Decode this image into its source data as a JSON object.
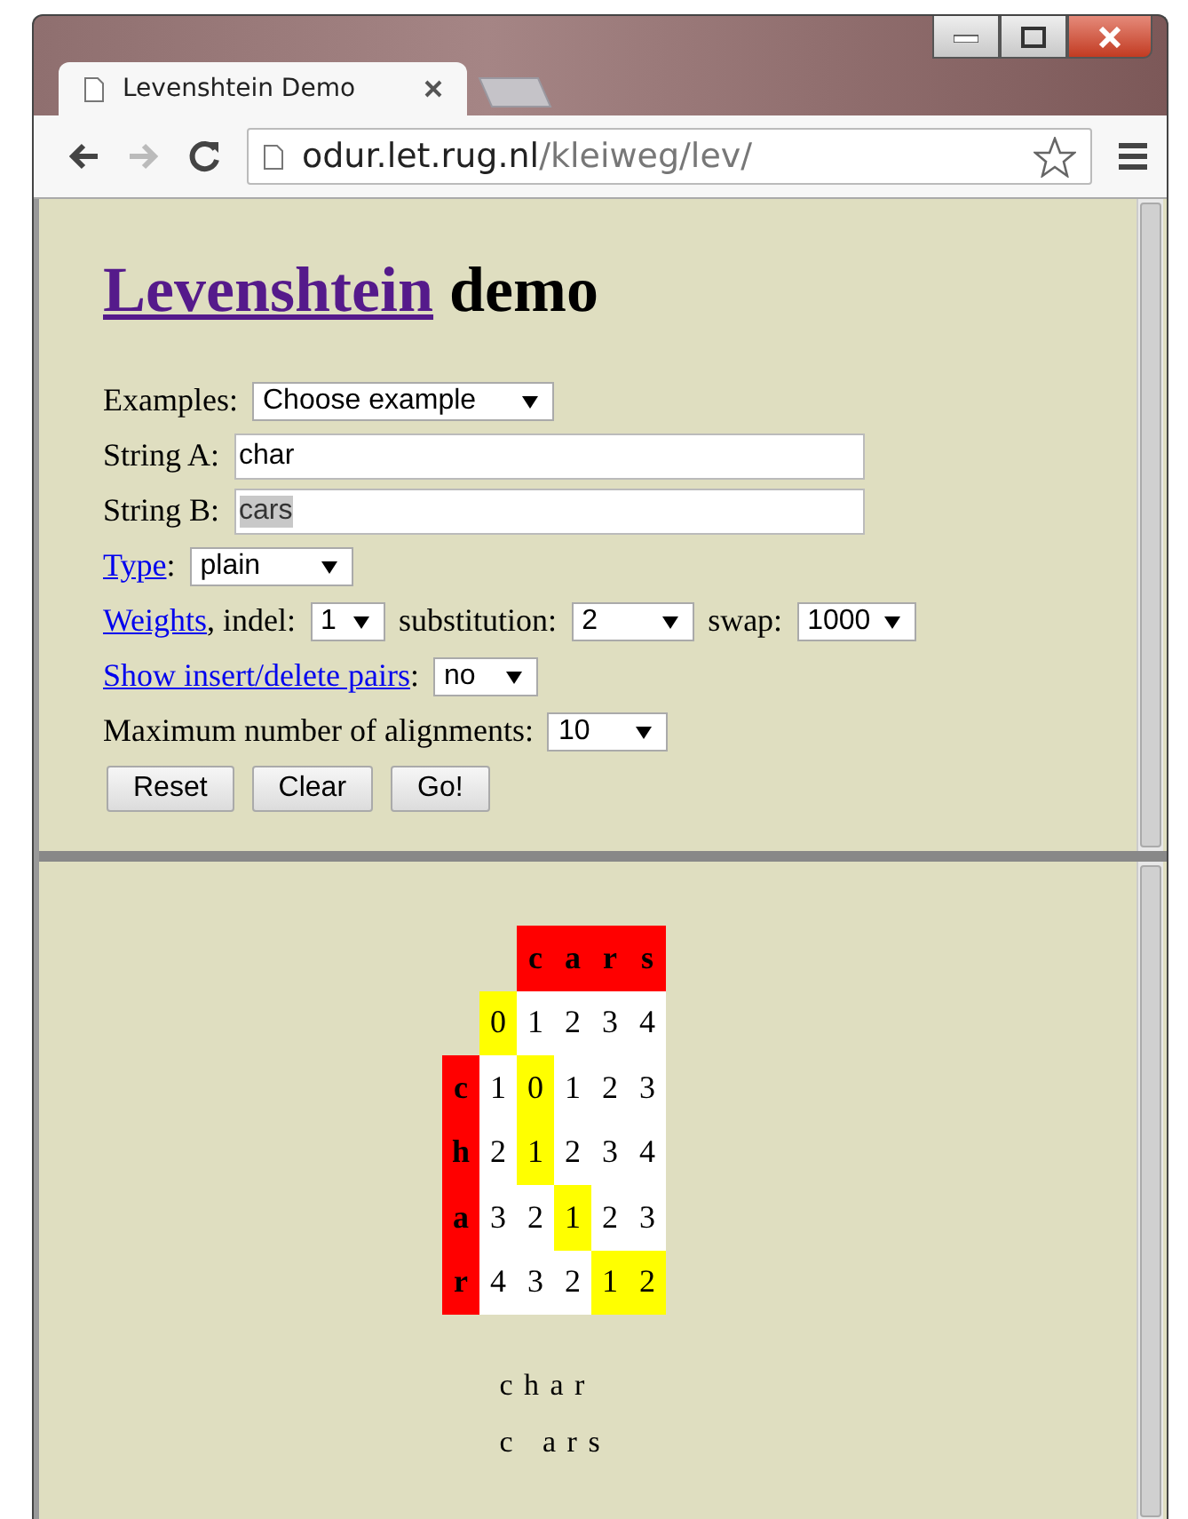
{
  "browser": {
    "tab_title": "Levenshtein Demo",
    "url_host": "odur.let.rug.nl",
    "url_path": "/kleiweg/lev/"
  },
  "heading": {
    "link": "Levenshtein",
    "rest": "demo"
  },
  "form": [
    [
      {
        "kind": "text",
        "text": "Examples:"
      },
      {
        "kind": "select",
        "value": "Choose example"
      }
    ],
    [
      {
        "kind": "text",
        "text": "String A:"
      },
      {
        "kind": "input",
        "value": "char",
        "highlighted": false
      }
    ],
    [
      {
        "kind": "text",
        "text": "String B:"
      },
      {
        "kind": "input",
        "value": "cars",
        "highlighted": true
      }
    ],
    [
      {
        "kind": "link",
        "text": "Type"
      },
      {
        "kind": "text",
        "text": ":"
      },
      {
        "kind": "select",
        "value": "plain"
      }
    ],
    [
      {
        "kind": "link",
        "text": "Weights"
      },
      {
        "kind": "text",
        "text": ", indel:"
      },
      {
        "kind": "select",
        "value": "1"
      },
      {
        "kind": "text",
        "text": "substitution:"
      },
      {
        "kind": "select",
        "value": "2"
      },
      {
        "kind": "text",
        "text": "swap:"
      },
      {
        "kind": "select",
        "value": "1000"
      }
    ],
    [
      {
        "kind": "link",
        "text": "Show insert/delete pairs"
      },
      {
        "kind": "text",
        "text": ":"
      },
      {
        "kind": "select",
        "value": "no"
      }
    ],
    [
      {
        "kind": "text",
        "text": "Maximum number of alignments:"
      },
      {
        "kind": "select",
        "value": "10"
      }
    ]
  ],
  "buttons": [
    "Reset",
    "Clear",
    "Go!"
  ],
  "matrix": {
    "columns": [
      "",
      "",
      "c",
      "a",
      "r",
      "s"
    ],
    "rows": [
      {
        "cells": [
          {
            "kind": "empty"
          },
          {
            "value": "0",
            "on_path": true
          },
          {
            "value": "1",
            "on_path": false
          },
          {
            "value": "2",
            "on_path": false
          },
          {
            "value": "3",
            "on_path": false
          },
          {
            "value": "4",
            "on_path": false
          }
        ]
      },
      {
        "cells": [
          {
            "kind": "header",
            "value": "c"
          },
          {
            "value": "1",
            "on_path": false
          },
          {
            "value": "0",
            "on_path": true
          },
          {
            "value": "1",
            "on_path": false
          },
          {
            "value": "2",
            "on_path": false
          },
          {
            "value": "3",
            "on_path": false
          }
        ]
      },
      {
        "cells": [
          {
            "kind": "header",
            "value": "h"
          },
          {
            "value": "2",
            "on_path": false
          },
          {
            "value": "1",
            "on_path": true
          },
          {
            "value": "2",
            "on_path": false
          },
          {
            "value": "3",
            "on_path": false
          },
          {
            "value": "4",
            "on_path": false
          }
        ]
      },
      {
        "cells": [
          {
            "kind": "header",
            "value": "a"
          },
          {
            "value": "3",
            "on_path": false
          },
          {
            "value": "2",
            "on_path": false
          },
          {
            "value": "1",
            "on_path": true
          },
          {
            "value": "2",
            "on_path": false
          },
          {
            "value": "3",
            "on_path": false
          }
        ]
      },
      {
        "cells": [
          {
            "kind": "header",
            "value": "r"
          },
          {
            "value": "4",
            "on_path": false
          },
          {
            "value": "3",
            "on_path": false
          },
          {
            "value": "2",
            "on_path": false
          },
          {
            "value": "1",
            "on_path": true
          },
          {
            "value": "2",
            "on_path": true
          }
        ]
      }
    ]
  },
  "alignment": [
    "c h a r",
    "c   a r s"
  ]
}
